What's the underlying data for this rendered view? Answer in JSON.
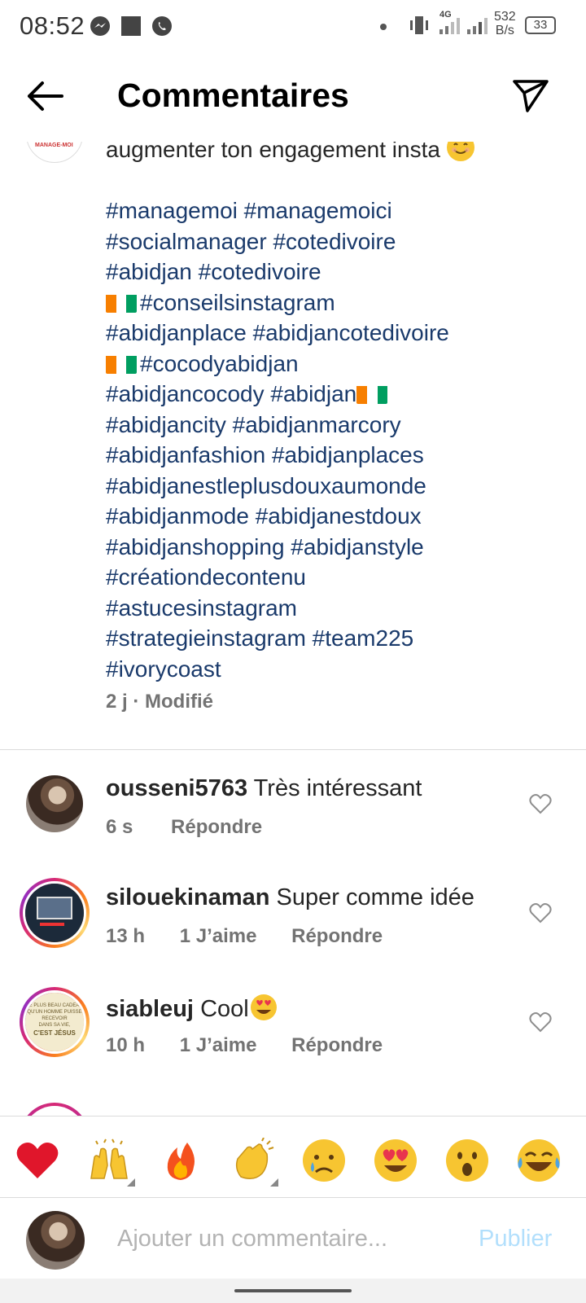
{
  "status_bar": {
    "time": "08:52",
    "network_speed": "532",
    "network_unit": "B/s",
    "battery": "33",
    "network_type": "4G"
  },
  "header": {
    "title": "Commentaires"
  },
  "caption": {
    "first_line": "augmenter ton engagement insta",
    "lines": [
      {
        "flag_before": false,
        "flag_after": false,
        "text": "#managemoi #managemoici"
      },
      {
        "flag_before": false,
        "flag_after": false,
        "text": "#socialmanager #cotedivoire"
      },
      {
        "flag_before": false,
        "flag_after": false,
        "text": "#abidjan #cotedivoire"
      },
      {
        "flag_before": true,
        "flag_after": false,
        "text": "#conseilsinstagram"
      },
      {
        "flag_before": false,
        "flag_after": false,
        "text": "#abidjanplace #abidjancotedivoire"
      },
      {
        "flag_before": true,
        "flag_after": false,
        "text": "#cocodyabidjan"
      },
      {
        "flag_before": false,
        "flag_after": true,
        "text": "#abidjancocody #abidjan"
      },
      {
        "flag_before": false,
        "flag_after": false,
        "text": "#abidjancity #abidjanmarcory"
      },
      {
        "flag_before": false,
        "flag_after": false,
        "text": "#abidjanfashion #abidjanplaces"
      },
      {
        "flag_before": false,
        "flag_after": false,
        "text": "#abidjanestleplusdouxaumonde"
      },
      {
        "flag_before": false,
        "flag_after": false,
        "text": "#abidjanmode #abidjanestdoux"
      },
      {
        "flag_before": false,
        "flag_after": false,
        "text": "#abidjanshopping #abidjanstyle"
      },
      {
        "flag_before": false,
        "flag_after": false,
        "text": "#créationdecontenu"
      },
      {
        "flag_before": false,
        "flag_after": false,
        "text": "#astucesinstagram"
      },
      {
        "flag_before": false,
        "flag_after": false,
        "text": "#strategieinstagram #team225"
      },
      {
        "flag_before": false,
        "flag_after": false,
        "text": "#ivorycoast"
      }
    ],
    "meta": "2 j · Modifié",
    "avatar_text": "MANAGE-MOI"
  },
  "comments": [
    {
      "username": "ousseni5763",
      "text": "Très intéressant",
      "time": "6 s",
      "likes": "",
      "reply": "Répondre",
      "emoji": ""
    },
    {
      "username": "silouekinaman",
      "text": "Super comme idée",
      "time": "13 h",
      "likes": "1 J’aime",
      "reply": "Répondre",
      "emoji": ""
    },
    {
      "username": "siableuj",
      "text": "Cool",
      "time": "10 h",
      "likes": "1 J’aime",
      "reply": "Répondre",
      "emoji": "heart-eyes"
    }
  ],
  "avatar_poster_text": [
    "LE PLUS BEAU CADEAU",
    "QU'UN HOMME PUISSE RECEVOIR",
    "DANS SA VIE,",
    "C'EST JÉSUS"
  ],
  "emoji_bar": [
    "red-heart",
    "raising-hands",
    "fire",
    "clapping-hands",
    "crying-face",
    "heart-eyes",
    "astonished-face",
    "tears-of-joy"
  ],
  "input": {
    "placeholder": "Ajouter un commentaire...",
    "publish": "Publier"
  },
  "colors": {
    "hashtag": "#1a3a6b",
    "publish_disabled": "#b2dffc",
    "meta": "#737373"
  }
}
